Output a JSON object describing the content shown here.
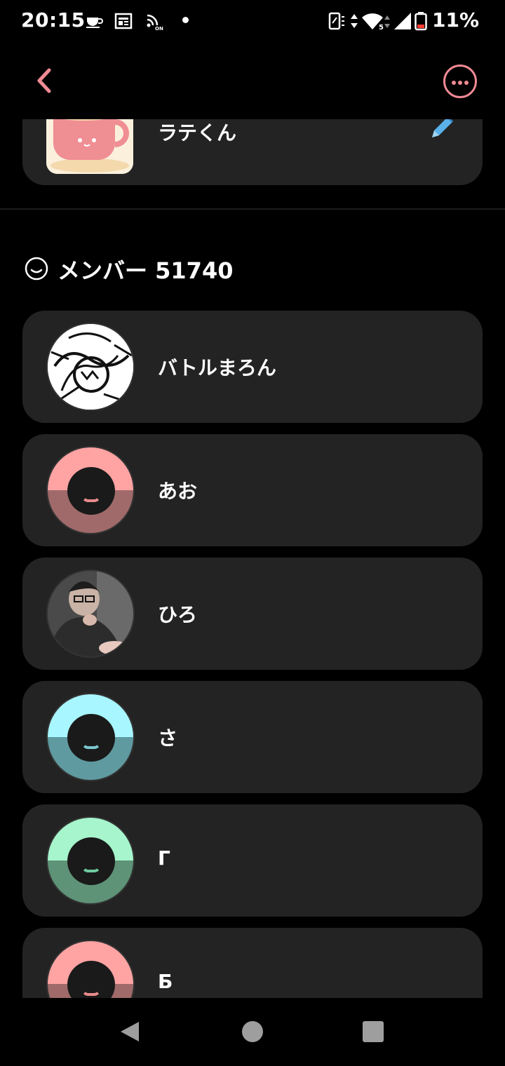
{
  "status_bar": {
    "time": "20:15",
    "battery_percent": "11%",
    "icons": [
      "coffee-icon",
      "news-icon",
      "nfc-icon",
      "notification-dot",
      "vibrate-icon",
      "data-arrows-icon",
      "wifi-icon",
      "signal-icon",
      "battery-icon"
    ]
  },
  "app_bar": {
    "back_icon": "chevron-left-icon",
    "more_icon": "more-horizontal-icon",
    "accent_color": "#f08a95"
  },
  "profile_card": {
    "name": "ラテくん",
    "edit_icon": "pencil-icon"
  },
  "members_section": {
    "title": "メンバー 51740",
    "icon": "smile-circle-icon"
  },
  "members": [
    {
      "name": "バトルまろん",
      "avatar": "sketch-photo"
    },
    {
      "name": "あお",
      "avatar": "default-face",
      "color_top": "#ffa3a3",
      "color_bottom": "#a06a6a",
      "smile": "#e88b8b"
    },
    {
      "name": "ひろ",
      "avatar": "person-photo"
    },
    {
      "name": "さ",
      "avatar": "default-face",
      "color_top": "#a8f6ff",
      "color_bottom": "#5f9aa0",
      "smile": "#7cc7cf"
    },
    {
      "name": "Г",
      "avatar": "default-face",
      "color_top": "#a6f5cc",
      "color_bottom": "#5e9377",
      "smile": "#6fc9a0"
    },
    {
      "name": "Б",
      "avatar": "default-face",
      "color_top": "#ffa3a3",
      "color_bottom": "#a06a6a",
      "smile": "#e88b8b"
    }
  ],
  "nav_bar": {
    "icons": [
      "nav-back-icon",
      "nav-home-icon",
      "nav-recents-icon"
    ]
  }
}
